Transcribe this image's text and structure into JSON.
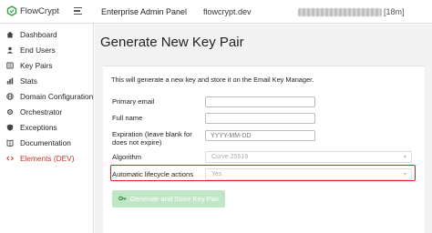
{
  "header": {
    "logo_text": "FlowCrypt",
    "title": "Enterprise Admin Panel",
    "domain": "flowcrypt.dev",
    "session_suffix": "[18m]"
  },
  "sidebar": {
    "items": [
      {
        "label": "Dashboard",
        "icon": "home-icon"
      },
      {
        "label": "End Users",
        "icon": "users-icon"
      },
      {
        "label": "Key Pairs",
        "icon": "key-icon"
      },
      {
        "label": "Stats",
        "icon": "stats-icon"
      },
      {
        "label": "Domain Configuration",
        "icon": "globe-icon"
      },
      {
        "label": "Orchestrator",
        "icon": "orchestrator-icon"
      },
      {
        "label": "Exceptions",
        "icon": "shield-icon"
      },
      {
        "label": "Documentation",
        "icon": "book-icon"
      },
      {
        "label": "Elements (DEV)",
        "icon": "code-icon"
      }
    ]
  },
  "main": {
    "page_title": "Generate New Key Pair",
    "intro": "This will generate a new key and store it on the Email Key Manager.",
    "form": {
      "primary_email_label": "Primary email",
      "full_name_label": "Full name",
      "expiration_label": "Expiration (leave blank for does not expire)",
      "expiration_placeholder": "YYYY-MM-DD",
      "algorithm_label": "Algorithm",
      "algorithm_value": "Curve 25519",
      "lifecycle_label": "Automatic lifecycle actions",
      "lifecycle_value": "Yes"
    },
    "submit_label": "Generate and Store Key Pair"
  },
  "colors": {
    "highlight": "#e02020",
    "button_bg": "#bfe7c5",
    "dev_item": "#c0392b"
  }
}
